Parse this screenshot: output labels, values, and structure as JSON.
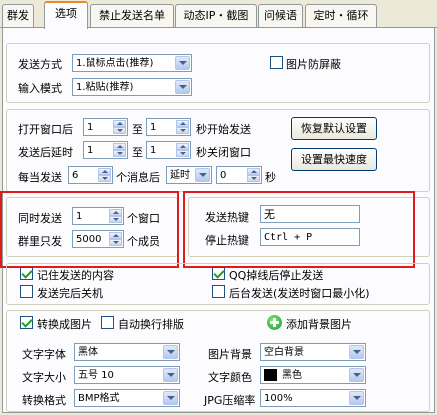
{
  "tabs": [
    "群发",
    "选项",
    "禁止发送名单",
    "动态IP・截图",
    "问候语",
    "定时・循环"
  ],
  "send": {
    "mode_label": "发送方式",
    "mode_value": "1.鼠标点击(推荐)",
    "input_label": "输入模式",
    "input_value": "1.粘贴(推荐)",
    "anti_screen_label": "图片防屏蔽"
  },
  "timing": {
    "open_label": "打开窗口后",
    "open_from": "1",
    "to1": "至",
    "open_to": "1",
    "open_suffix": "秒开始发送",
    "close_label": "发送后延时",
    "close_from": "1",
    "to2": "至",
    "close_to": "1",
    "close_suffix": "秒关闭窗口",
    "every_label": "每当发送",
    "every_count": "6",
    "every_mid": "个消息后",
    "delay_option": "延时",
    "delay_value": "0",
    "sec": "秒",
    "restore_button": "恢复默认设置",
    "fastest_button": "设置最快速度"
  },
  "batch": {
    "concurrent_label": "同时发送",
    "concurrent_value": "1",
    "concurrent_unit": "个窗口",
    "group_label": "群里只发",
    "group_value": "5000",
    "group_unit": "个成员"
  },
  "hotkeys": {
    "send_label": "发送热键",
    "send_value": "无",
    "stop_label": "停止热键",
    "stop_value": "Ctrl + P"
  },
  "options": {
    "remember_label": "记住发送的内容",
    "qq_stop_label": "QQ掉线后停止发送",
    "shutdown_label": "发送完后关机",
    "background_label": "后台发送(发送时窗口最小化)"
  },
  "image": {
    "convert_label": "转换成图片",
    "wrap_label": "自动换行排版",
    "add_bg_label": "添加背景图片",
    "font_label": "文字字体",
    "font_value": "黑体",
    "bg_label": "图片背景",
    "bg_value": "空白背景",
    "size_label": "文字大小",
    "size_value": "五号 10",
    "color_label": "文字颜色",
    "color_value": "黑色",
    "format_label": "转换格式",
    "format_value": "BMP格式",
    "jpg_label": "JPG压缩率",
    "jpg_value": "100%"
  },
  "colors": {
    "highlight_border": "#e11b1b",
    "active_tab_accent": "#e68b2c",
    "text_color_swatch": "#000000"
  }
}
